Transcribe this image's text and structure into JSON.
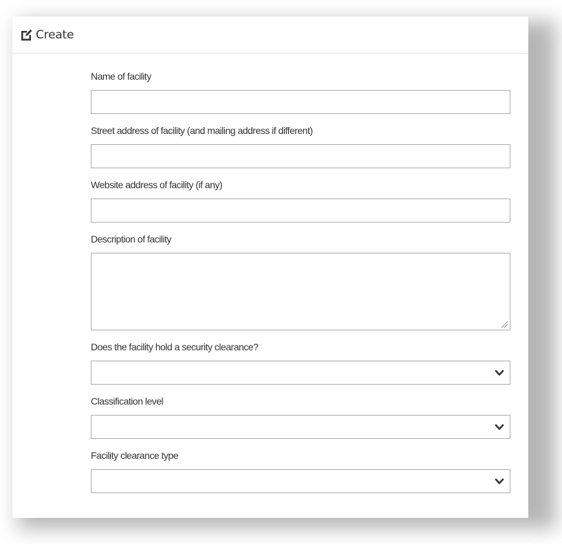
{
  "header": {
    "title": "Create",
    "icon": "edit-icon"
  },
  "form": {
    "name": {
      "label": "Name of facility",
      "value": ""
    },
    "street_address": {
      "label": "Street address of facility (and mailing address if different)",
      "value": ""
    },
    "website": {
      "label": "Website address of facility (if any)",
      "value": ""
    },
    "description": {
      "label": "Description of facility",
      "value": ""
    },
    "security_clearance": {
      "label": "Does the facility hold a security clearance?",
      "selected": ""
    },
    "classification_level": {
      "label": "Classification level",
      "selected": ""
    },
    "clearance_type": {
      "label": "Facility clearance type",
      "selected": ""
    }
  },
  "colors": {
    "border": "#aaaaaa",
    "text": "#333333",
    "shadow": "#a9a9a9"
  }
}
